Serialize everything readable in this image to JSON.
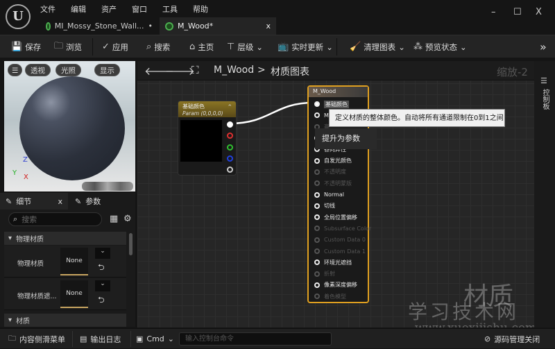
{
  "menu": [
    "文件",
    "编辑",
    "资产",
    "窗口",
    "工具",
    "帮助"
  ],
  "tabs": [
    {
      "label": "MI_Mossy_Stone_Wall...",
      "mark": "•"
    },
    {
      "label": "M_Wood*",
      "close": "x"
    }
  ],
  "window": {
    "minimize": "–",
    "maximize": "☐",
    "close": "X"
  },
  "toolbar": {
    "save": "保存",
    "browse": "浏览",
    "apply": "应用",
    "search": "搜索",
    "home": "主页",
    "hierarchy": "层级",
    "live_update": "实时更新",
    "clean_graph": "清理图表",
    "preview_state": "预览状态",
    "more": "»"
  },
  "viewport": {
    "menu": "☰",
    "perspective": "透视",
    "lit": "光照",
    "show": "显示",
    "axis_z": "Z",
    "axis_y": "Y",
    "axis_x": "X"
  },
  "details": {
    "tab_details": "细节",
    "tab_close": "x",
    "tab_params": "参数",
    "search_placeholder": "搜索",
    "categories": [
      "物理材质",
      "材质"
    ],
    "rows": [
      {
        "label": "物理材质",
        "value": "None"
      },
      {
        "label": "物理材质遮...",
        "value": "None"
      }
    ]
  },
  "graph": {
    "breadcrumb_asset": "M_Wood",
    "breadcrumb_sep": ">",
    "breadcrumb_graph": "材质图表",
    "zoom": "缩放-2"
  },
  "param_node": {
    "title": "基础颜色",
    "subtitle": "Param (0,0,0,0)",
    "pin_colors": [
      "#ffffff",
      "#e03030",
      "#30c030",
      "#2040e0",
      "#cccccc"
    ]
  },
  "material_node": {
    "title": "M_Wood",
    "pins": [
      {
        "label": "基础颜色",
        "active": true
      },
      {
        "label": "M",
        "active": true
      },
      {
        "label": "高",
        "active": false
      },
      {
        "label": "",
        "active": true
      },
      {
        "label": "各向异性",
        "active": true
      },
      {
        "label": "自发光颜色",
        "active": true
      },
      {
        "label": "不透明度",
        "active": false
      },
      {
        "label": "不透明蒙版",
        "active": false
      },
      {
        "label": "Normal",
        "active": true
      },
      {
        "label": "切线",
        "active": true
      },
      {
        "label": "全局位置偏移",
        "active": true
      },
      {
        "label": "Subsurface Color",
        "active": false
      },
      {
        "label": "Custom Data 0",
        "active": false
      },
      {
        "label": "Custom Data 1",
        "active": false
      },
      {
        "label": "环境光遮挡",
        "active": true
      },
      {
        "label": "折射",
        "active": false
      },
      {
        "label": "像素深度偏移",
        "active": true
      },
      {
        "label": "着色模型",
        "active": false
      }
    ]
  },
  "tooltip": "定义材质的整体颜色。自动将所有通道限制在0到1之间",
  "context_popup": "提升为参数",
  "side_tab": "控制板",
  "bottom": {
    "content_drawer": "内容侧滑菜单",
    "output_log": "输出日志",
    "cmd": "Cmd",
    "cmd_placeholder": "输入控制台命令",
    "source_control": "源码管理关闭"
  },
  "watermark": {
    "line1": "材质",
    "line2": "学习技术网",
    "url": "www.xuexijishu.com"
  },
  "colors": {
    "accent_node_border": "#e0a020",
    "param_header": "#8a7424"
  }
}
